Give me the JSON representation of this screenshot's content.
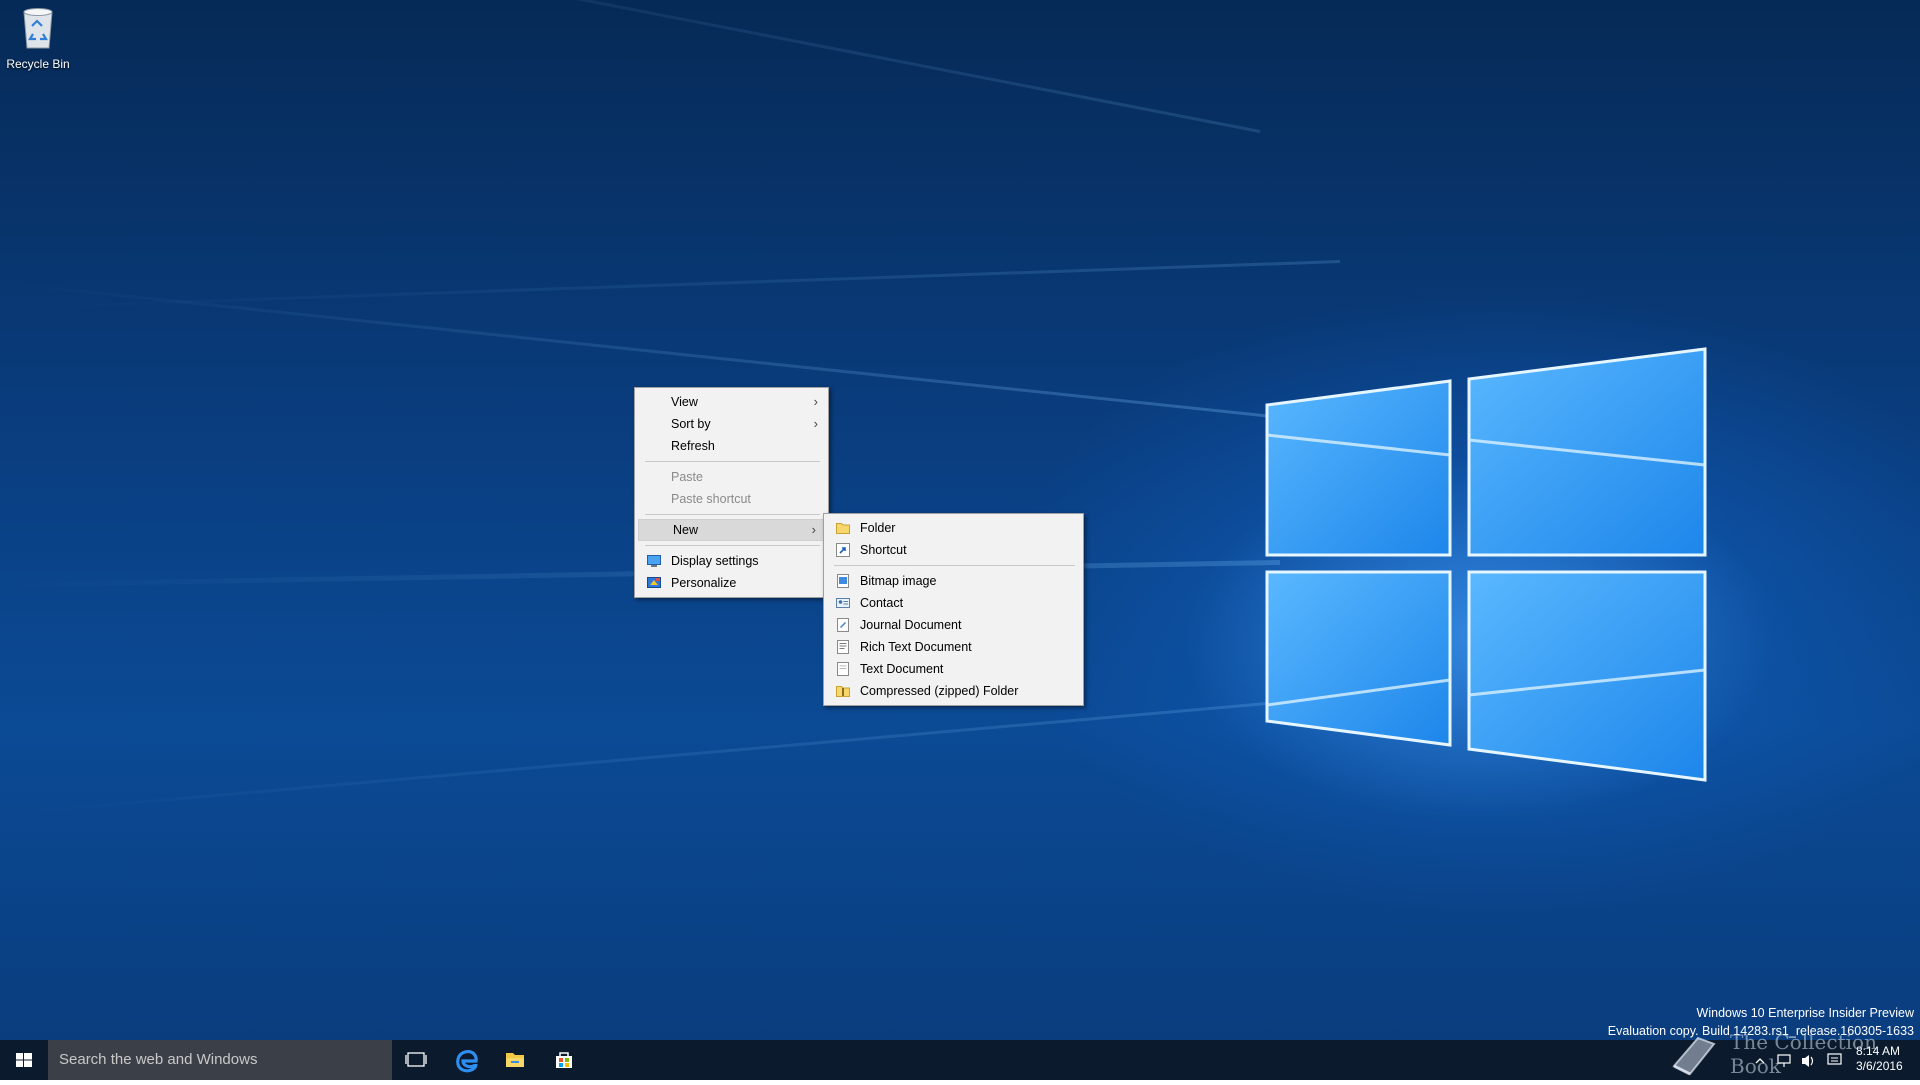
{
  "desktop": {
    "icons": [
      {
        "label": "Recycle Bin",
        "icon": "recycle-bin-icon"
      }
    ],
    "watermark": {
      "line1": "Windows 10 Enterprise Insider Preview",
      "line2": "Evaluation copy. Build 14283.rs1_release.160305-1633"
    },
    "overlay_text": "The Collection Book"
  },
  "context_menu": {
    "items": [
      {
        "label": "View",
        "submenu": true
      },
      {
        "label": "Sort by",
        "submenu": true
      },
      {
        "label": "Refresh"
      },
      {
        "label": "Paste",
        "disabled": true
      },
      {
        "label": "Paste shortcut",
        "disabled": true
      },
      {
        "label": "New",
        "submenu": true,
        "active": true
      },
      {
        "label": "Display settings",
        "icon": "display-icon"
      },
      {
        "label": "Personalize",
        "icon": "personalize-icon"
      }
    ]
  },
  "new_submenu": {
    "items": [
      {
        "label": "Folder",
        "icon": "folder-icon"
      },
      {
        "label": "Shortcut",
        "icon": "shortcut-icon"
      },
      {
        "label": "Bitmap image",
        "icon": "bitmap-icon"
      },
      {
        "label": "Contact",
        "icon": "contact-icon"
      },
      {
        "label": "Journal Document",
        "icon": "journal-icon"
      },
      {
        "label": "Rich Text Document",
        "icon": "rich-text-icon"
      },
      {
        "label": "Text Document",
        "icon": "text-document-icon"
      },
      {
        "label": "Compressed (zipped) Folder",
        "icon": "zip-folder-icon"
      }
    ]
  },
  "taskbar": {
    "search_placeholder": "Search the web and Windows",
    "clock_time": "8:14 AM",
    "clock_date": "3/6/2016"
  },
  "colors": {
    "menu_bg": "#f2f2f2",
    "taskbar_bg": "#0b1a2c",
    "search_bg": "#3b4048",
    "accent_blue": "#1e88e5"
  }
}
